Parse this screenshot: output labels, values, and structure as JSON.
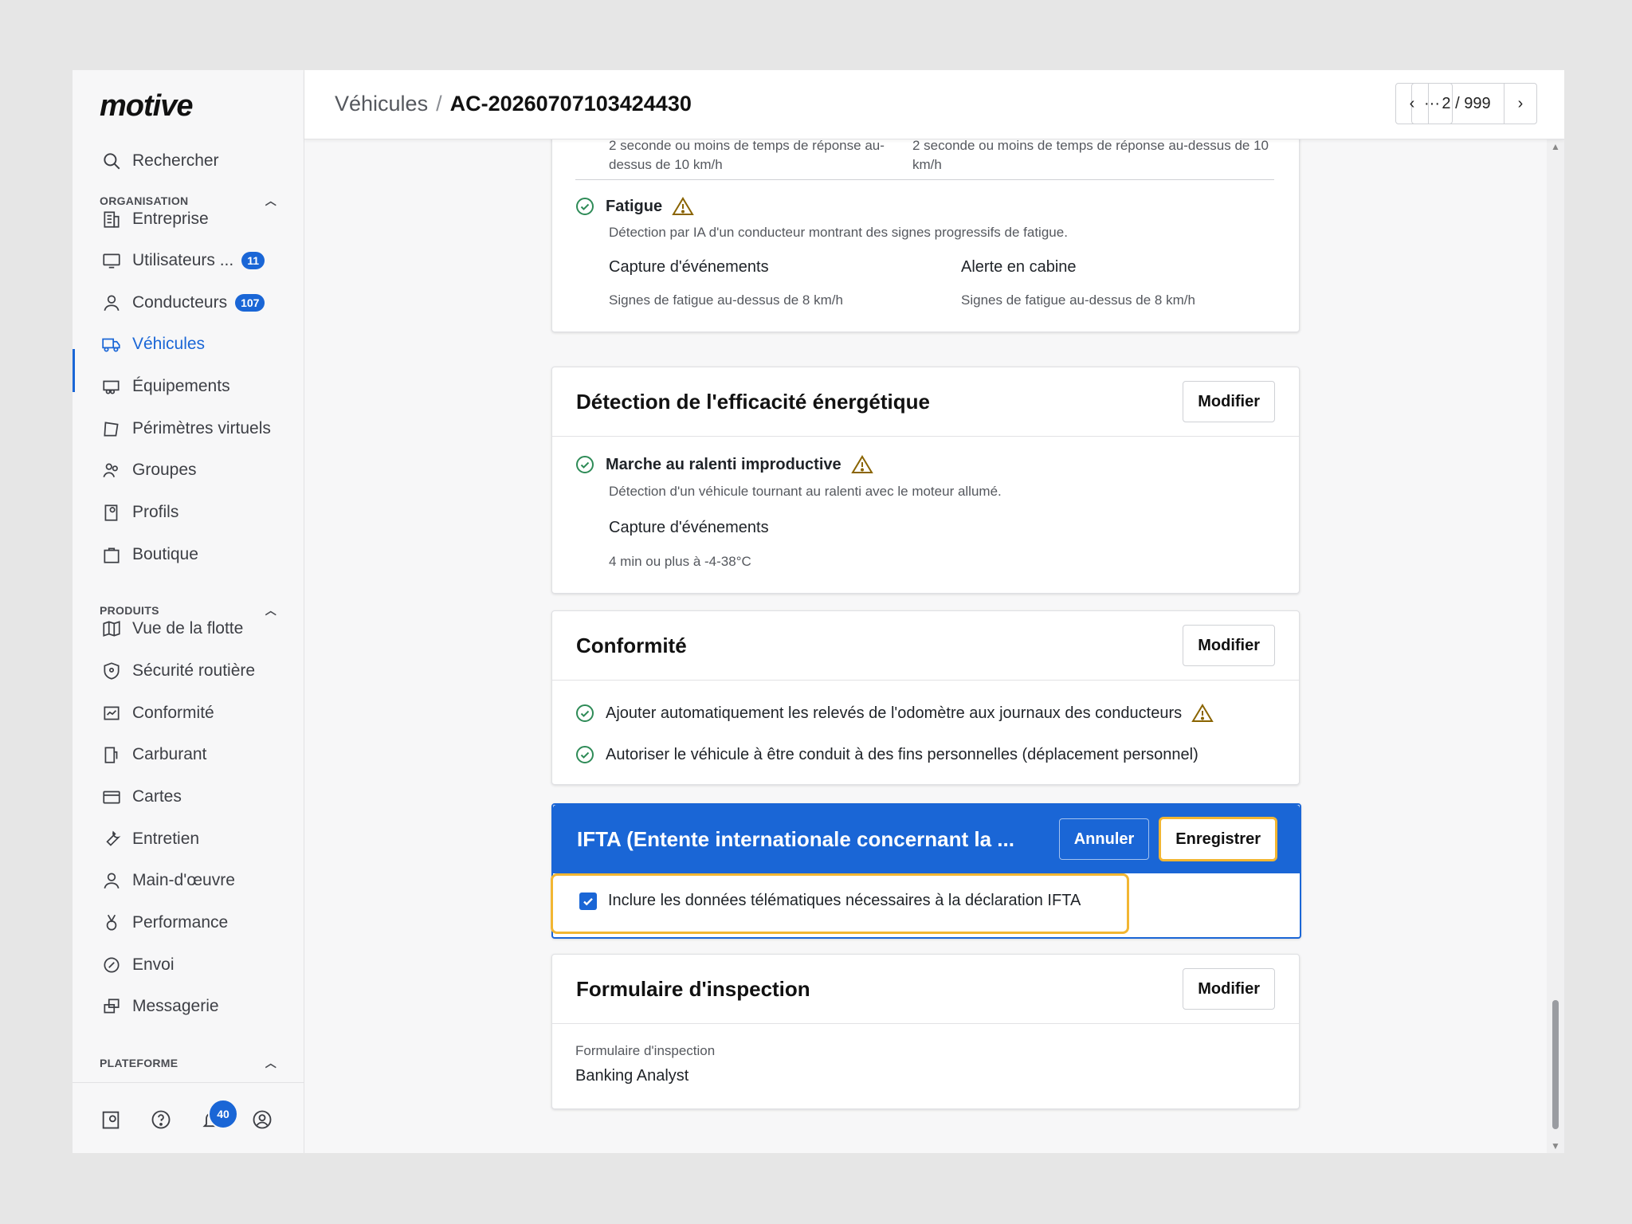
{
  "sidebar": {
    "logo": "motive",
    "search_label": "Rechercher",
    "sections": {
      "organisation": "ORGANISATION",
      "produits": "PRODUITS",
      "plateforme": "PLATEFORME"
    },
    "org_items": [
      {
        "label": "Entreprise"
      },
      {
        "label": "Utilisateurs ...",
        "badge": "11"
      },
      {
        "label": "Conducteurs",
        "badge": "107"
      },
      {
        "label": "Véhicules"
      },
      {
        "label": "Équipements"
      },
      {
        "label": "Périmètres virtuels"
      },
      {
        "label": "Groupes"
      },
      {
        "label": "Profils"
      },
      {
        "label": "Boutique"
      }
    ],
    "product_items": [
      {
        "label": "Vue de la flotte"
      },
      {
        "label": "Sécurité routière"
      },
      {
        "label": "Conformité"
      },
      {
        "label": "Carburant"
      },
      {
        "label": "Cartes"
      },
      {
        "label": "Entretien"
      },
      {
        "label": "Main-d'œuvre"
      },
      {
        "label": "Performance"
      },
      {
        "label": "Envoi"
      },
      {
        "label": "Messagerie"
      }
    ],
    "notification_count": "40"
  },
  "header": {
    "breadcrumb_parent": "Véhicules",
    "breadcrumb_sep": "/",
    "breadcrumb_current": "AC-20260707103424430",
    "more_label": "···",
    "pager_text": "2 / 999"
  },
  "fatigue_card": {
    "top_left": "2 seconde ou moins de temps de réponse au-dessus de 10 km/h",
    "top_right": "2 seconde ou moins de temps de réponse au-dessus de 10 km/h",
    "title": "Fatigue",
    "desc": "Détection par IA d'un conducteur montrant des signes progressifs de fatigue.",
    "col1_h": "Capture d'événements",
    "col1_v": "Signes de fatigue au-dessus de 8 km/h",
    "col2_h": "Alerte en cabine",
    "col2_v": "Signes de fatigue au-dessus de 8 km/h"
  },
  "energy_card": {
    "title": "Détection de l'efficacité énergétique",
    "modify": "Modifier",
    "item_title": "Marche au ralenti improductive",
    "item_desc": "Détection d'un véhicule tournant au ralenti avec le moteur allumé.",
    "sub_h": "Capture d'événements",
    "sub_v": "4 min ou plus à -4-38°C"
  },
  "compliance_card": {
    "title": "Conformité",
    "modify": "Modifier",
    "item1": "Ajouter automatiquement les relevés de l'odomètre aux journaux des conducteurs",
    "item2": "Autoriser le véhicule à être conduit à des fins personnelles (déplacement personnel)"
  },
  "ifta_card": {
    "title": "IFTA (Entente internationale concernant la ...",
    "cancel": "Annuler",
    "save": "Enregistrer",
    "checkbox_label": "Inclure les données télématiques nécessaires à la déclaration IFTA",
    "checked": true
  },
  "inspection_card": {
    "title": "Formulaire d'inspection",
    "modify": "Modifier",
    "field_label": "Formulaire d'inspection",
    "field_value": "Banking Analyst"
  },
  "colors": {
    "accent": "#1a66d6",
    "highlight": "#f2b632",
    "success": "#2e8b57",
    "warning": "#a07000"
  }
}
